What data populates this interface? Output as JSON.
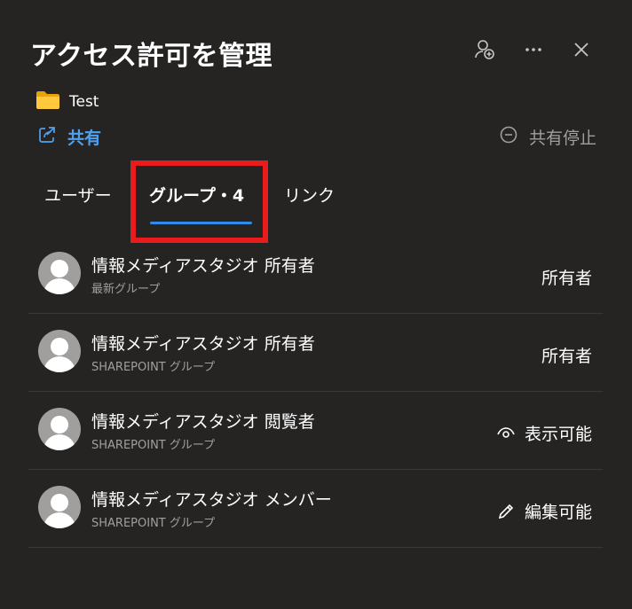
{
  "header": {
    "title": "アクセス許可を管理"
  },
  "item": {
    "icon": "folder-icon",
    "name": "Test"
  },
  "actions": {
    "share_label": "共有",
    "stop_share_label": "共有停止"
  },
  "tabs": [
    {
      "label": "ユーザー"
    },
    {
      "label": "グループ・4"
    },
    {
      "label": "リンク"
    }
  ],
  "groups": [
    {
      "name": "情報メディアスタジオ 所有者",
      "type": "最新グループ",
      "permission": "所有者",
      "permission_icon": ""
    },
    {
      "name": "情報メディアスタジオ 所有者",
      "type": "SHAREPOINT グループ",
      "permission": "所有者",
      "permission_icon": ""
    },
    {
      "name": "情報メディアスタジオ 閲覧者",
      "type": "SHAREPOINT グループ",
      "permission": "表示可能",
      "permission_icon": "eye-icon"
    },
    {
      "name": "情報メディアスタジオ メンバー",
      "type": "SHAREPOINT グループ",
      "permission": "編集可能",
      "permission_icon": "pencil-icon"
    }
  ],
  "colors": {
    "background": "#252423",
    "accent": "#2f8ae8",
    "link": "#4ea1f1",
    "highlight": "#e81c1c"
  }
}
